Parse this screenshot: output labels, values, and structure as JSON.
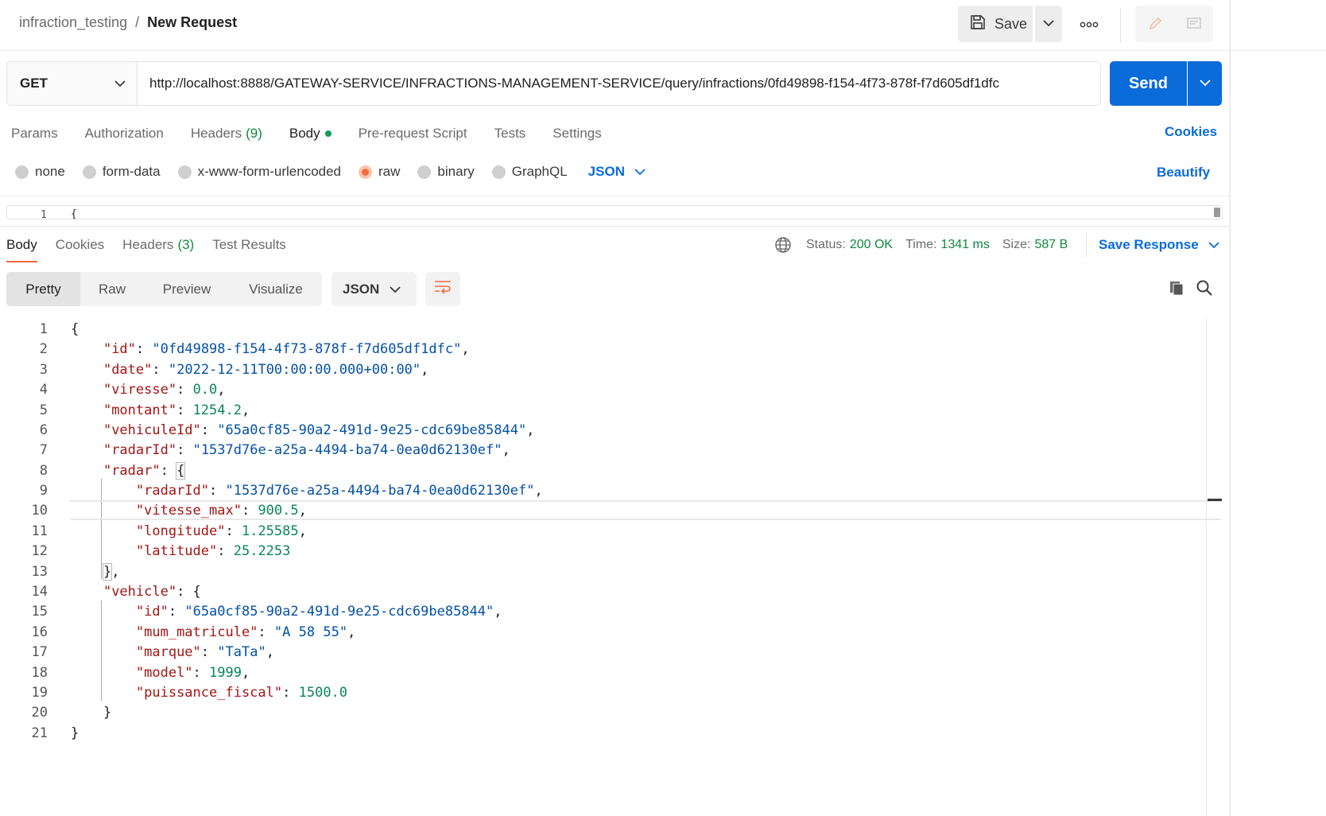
{
  "header": {
    "collection": "infraction_testing",
    "separator": "/",
    "request_name": "New Request",
    "save_label": "Save"
  },
  "request": {
    "method": "GET",
    "url": "http://localhost:8888/GATEWAY-SERVICE/INFRACTIONS-MANAGEMENT-SERVICE/query/infractions/0fd49898-f154-4f73-878f-f7d605df1dfc",
    "send_label": "Send",
    "tabs": [
      {
        "label": "Params"
      },
      {
        "label": "Authorization"
      },
      {
        "label": "Headers",
        "count": "(9)"
      },
      {
        "label": "Body"
      },
      {
        "label": "Pre-request Script"
      },
      {
        "label": "Tests"
      },
      {
        "label": "Settings"
      }
    ],
    "cookies_label": "Cookies",
    "body_types": [
      "none",
      "form-data",
      "x-www-form-urlencoded",
      "raw",
      "binary",
      "GraphQL"
    ],
    "body_type_selected": "raw",
    "body_format": "JSON",
    "beautify_label": "Beautify",
    "editor_line": "1",
    "editor_text": "{"
  },
  "response": {
    "tabs": [
      {
        "label": "Body"
      },
      {
        "label": "Cookies"
      },
      {
        "label": "Headers",
        "count": "(3)"
      },
      {
        "label": "Test Results"
      }
    ],
    "status_label": "Status:",
    "status_value": "200 OK",
    "time_label": "Time:",
    "time_value": "1341 ms",
    "size_label": "Size:",
    "size_value": "587 B",
    "save_response_label": "Save Response",
    "views": [
      "Pretty",
      "Raw",
      "Preview",
      "Visualize"
    ],
    "format": "JSON",
    "lines": [
      {
        "n": "1"
      },
      {
        "n": "2"
      },
      {
        "n": "3"
      },
      {
        "n": "4"
      },
      {
        "n": "5"
      },
      {
        "n": "6"
      },
      {
        "n": "7"
      },
      {
        "n": "8"
      },
      {
        "n": "9"
      },
      {
        "n": "10"
      },
      {
        "n": "11"
      },
      {
        "n": "12"
      },
      {
        "n": "13"
      },
      {
        "n": "14"
      },
      {
        "n": "15"
      },
      {
        "n": "16"
      },
      {
        "n": "17"
      },
      {
        "n": "18"
      },
      {
        "n": "19"
      },
      {
        "n": "20"
      },
      {
        "n": "21"
      }
    ],
    "json": {
      "id": "0fd49898-f154-4f73-878f-f7d605df1dfc",
      "date": "2022-12-11T00:00:00.000+00:00",
      "viresse": "0.0",
      "montant": "1254.2",
      "vehiculeId": "65a0cf85-90a2-491d-9e25-cdc69be85844",
      "radarId": "1537d76e-a25a-4494-ba74-0ea0d62130ef",
      "radar": {
        "radarId": "1537d76e-a25a-4494-ba74-0ea0d62130ef",
        "vitesse_max": "900.5",
        "longitude": "1.25585",
        "latitude": "25.2253"
      },
      "vehicle": {
        "id": "65a0cf85-90a2-491d-9e25-cdc69be85844",
        "mum_matricule": "A 58 55",
        "marque": "TaTa",
        "model": "1999",
        "puissance_fiscal": "1500.0"
      }
    }
  },
  "colors": {
    "accent_blue": "#0b6bd9",
    "accent_orange": "#f26b3a",
    "success_green": "#0f8a3f"
  },
  "icons": [
    "save-icon",
    "chevron-down-icon",
    "more-icon",
    "edit-icon",
    "comment-icon",
    "globe-icon",
    "wrap-icon",
    "copy-icon",
    "search-icon"
  ]
}
